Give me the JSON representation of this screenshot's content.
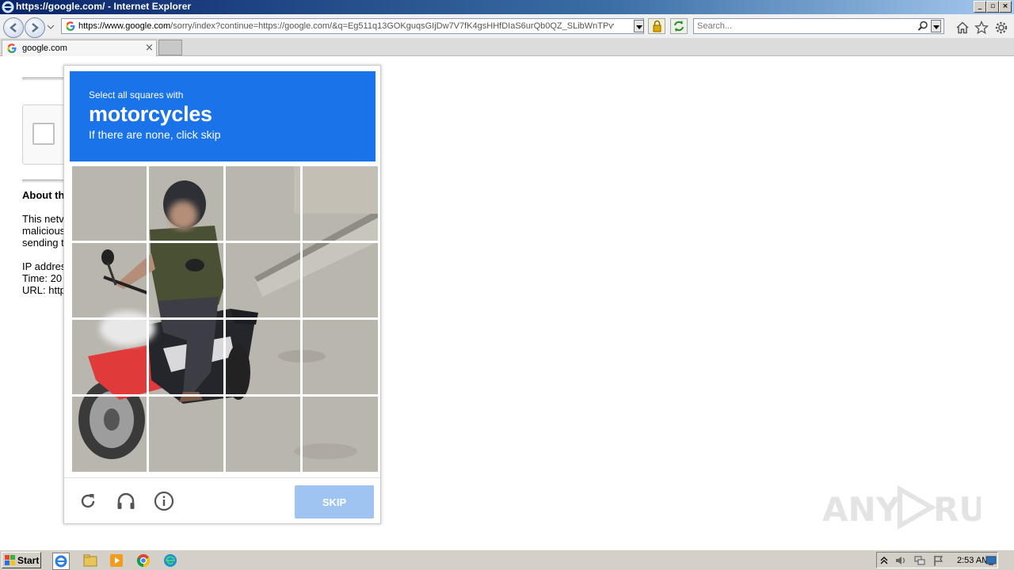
{
  "browser": {
    "window_title": "https://google.com/ - Internet Explorer",
    "address_url_main": "https://www.google.com",
    "address_url_rest": "/sorry/index?continue=https://google.com/&q=Eg511q13GOKguqsGIjDw7V7fK4gsHHfDIaS6urQb0QZ_SLibWnTPvvBDwE",
    "search_placeholder": "Search...",
    "tab_label": "google.com"
  },
  "page": {
    "about_heading": "About th",
    "para_line1": "This netv",
    "para_line2": "malicious",
    "para_line3": "sending t",
    "ip_line": "IP addres",
    "time_line": "Time: 20",
    "url_line": "URL: http"
  },
  "captcha": {
    "instruction_line1": "Select all squares with",
    "target_object": "motorcycles",
    "instruction_line3": "If there are none, click skip",
    "skip_label": "SKIP",
    "header_color": "#1a73e8",
    "grid_rows": 4,
    "grid_cols": 4,
    "footer_icons": [
      "reload-icon",
      "audio-headphones-icon",
      "info-icon"
    ]
  },
  "watermark": {
    "text": "ANY RUN"
  },
  "taskbar": {
    "start_label": "Start",
    "clock": "2:53 AM",
    "pinned_icons": [
      "internet-explorer-icon",
      "file-explorer-icon",
      "media-player-icon",
      "chrome-icon",
      "edge-icon"
    ]
  }
}
